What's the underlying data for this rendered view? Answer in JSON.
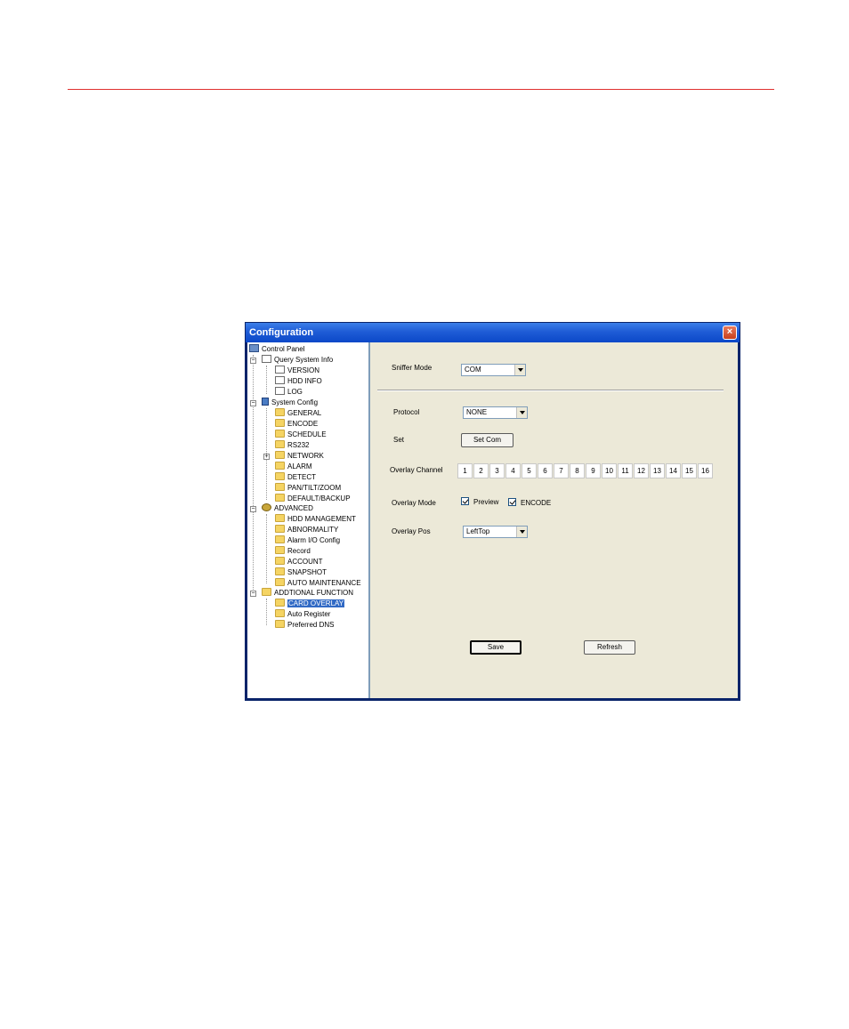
{
  "window": {
    "title": "Configuration"
  },
  "tree": {
    "root": "Control Panel",
    "query": {
      "label": "Query System Info",
      "items": [
        "VERSION",
        "HDD INFO",
        "LOG"
      ]
    },
    "system": {
      "label": "System Config",
      "items": [
        "GENERAL",
        "ENCODE",
        "SCHEDULE",
        "RS232",
        "NETWORK",
        "ALARM",
        "DETECT",
        "PAN/TILT/ZOOM",
        "DEFAULT/BACKUP"
      ]
    },
    "advanced": {
      "label": "ADVANCED",
      "items": [
        "HDD MANAGEMENT",
        "ABNORMALITY",
        "Alarm I/O Config",
        "Record",
        "ACCOUNT",
        "SNAPSHOT",
        "AUTO MAINTENANCE"
      ]
    },
    "additional": {
      "label": "ADDTIONAL FUNCTION",
      "items": [
        "CARD OVERLAY",
        "Auto Register",
        "Preferred DNS"
      ]
    },
    "selected": "CARD OVERLAY"
  },
  "form": {
    "sniffer_mode_label": "Sniffer Mode",
    "sniffer_mode_value": "COM",
    "protocol_label": "Protocol",
    "protocol_value": "NONE",
    "set_label": "Set",
    "set_com_button": "Set Com",
    "overlay_channel_label": "Overlay Channel",
    "channels": [
      "1",
      "2",
      "3",
      "4",
      "5",
      "6",
      "7",
      "8",
      "9",
      "10",
      "11",
      "12",
      "13",
      "14",
      "15",
      "16"
    ],
    "overlay_mode_label": "Overlay Mode",
    "preview_label": "Preview",
    "preview_checked": true,
    "encode_label": "ENCODE",
    "encode_checked": true,
    "overlay_pos_label": "Overlay Pos",
    "overlay_pos_value": "LeftTop",
    "save_button": "Save",
    "refresh_button": "Refresh"
  }
}
